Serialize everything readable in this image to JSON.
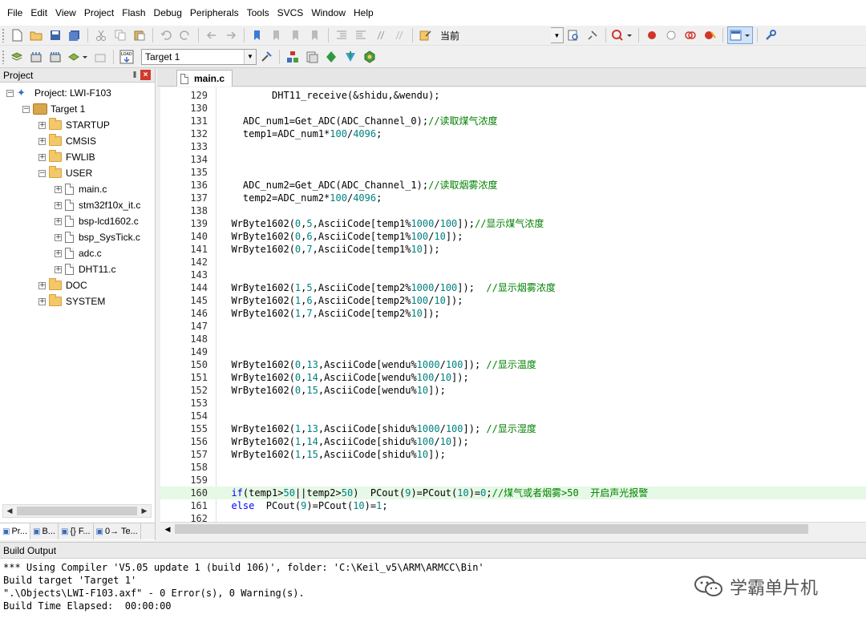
{
  "menu": [
    "File",
    "Edit",
    "View",
    "Project",
    "Flash",
    "Debug",
    "Peripherals",
    "Tools",
    "SVCS",
    "Window",
    "Help"
  ],
  "toolbar1": {
    "current_label": "当前"
  },
  "toolbar2": {
    "target_combo": "Target 1",
    "load_label": "LOAD"
  },
  "project_panel": {
    "title": "Project",
    "pin_glyph": "‖",
    "close_glyph": "×",
    "tree": [
      {
        "label": "Project: LWI-F103",
        "depth": 0,
        "kind": "project",
        "expander": "−"
      },
      {
        "label": "Target 1",
        "depth": 1,
        "kind": "target",
        "expander": "−"
      },
      {
        "label": "STARTUP",
        "depth": 2,
        "kind": "folder",
        "expander": "+"
      },
      {
        "label": "CMSIS",
        "depth": 2,
        "kind": "folder",
        "expander": "+"
      },
      {
        "label": "FWLIB",
        "depth": 2,
        "kind": "folder",
        "expander": "+"
      },
      {
        "label": "USER",
        "depth": 2,
        "kind": "folder",
        "expander": "−"
      },
      {
        "label": "main.c",
        "depth": 3,
        "kind": "file",
        "expander": "+"
      },
      {
        "label": "stm32f10x_it.c",
        "depth": 3,
        "kind": "file",
        "expander": "+"
      },
      {
        "label": "bsp-lcd1602.c",
        "depth": 3,
        "kind": "file",
        "expander": "+"
      },
      {
        "label": "bsp_SysTick.c",
        "depth": 3,
        "kind": "file",
        "expander": "+"
      },
      {
        "label": "adc.c",
        "depth": 3,
        "kind": "file",
        "expander": "+"
      },
      {
        "label": "DHT11.c",
        "depth": 3,
        "kind": "file",
        "expander": "+"
      },
      {
        "label": "DOC",
        "depth": 2,
        "kind": "folder",
        "expander": "+"
      },
      {
        "label": "SYSTEM",
        "depth": 2,
        "kind": "folder",
        "expander": "+"
      }
    ],
    "tabs": [
      {
        "label": "Pr...",
        "icon": "project-icon"
      },
      {
        "label": "B...",
        "icon": "books-icon"
      },
      {
        "label": "{} F...",
        "icon": "functions-icon"
      },
      {
        "label": "0→ Te...",
        "icon": "templates-icon"
      }
    ]
  },
  "editor": {
    "active_tab": "main.c",
    "highlighted_line": 160,
    "lines": [
      {
        "n": "129",
        "code": "         DHT11_receive(&shidu,&wendu);"
      },
      {
        "n": "130",
        "code": ""
      },
      {
        "n": "131",
        "code": "    ADC_num1=Get_ADC(ADC_Channel_0);//读取煤气浓度"
      },
      {
        "n": "132",
        "code": "    temp1=ADC_num1*100/4096;"
      },
      {
        "n": "133",
        "code": ""
      },
      {
        "n": "134",
        "code": ""
      },
      {
        "n": "135",
        "code": ""
      },
      {
        "n": "136",
        "code": "    ADC_num2=Get_ADC(ADC_Channel_1);//读取烟雾浓度"
      },
      {
        "n": "137",
        "code": "    temp2=ADC_num2*100/4096;"
      },
      {
        "n": "138",
        "code": ""
      },
      {
        "n": "139",
        "code": "  WrByte1602(0,5,AsciiCode[temp1%1000/100]);//显示煤气浓度"
      },
      {
        "n": "140",
        "code": "  WrByte1602(0,6,AsciiCode[temp1%100/10]);"
      },
      {
        "n": "141",
        "code": "  WrByte1602(0,7,AsciiCode[temp1%10]);"
      },
      {
        "n": "142",
        "code": ""
      },
      {
        "n": "143",
        "code": ""
      },
      {
        "n": "144",
        "code": "  WrByte1602(1,5,AsciiCode[temp2%1000/100]);  //显示烟雾浓度"
      },
      {
        "n": "145",
        "code": "  WrByte1602(1,6,AsciiCode[temp2%100/10]);"
      },
      {
        "n": "146",
        "code": "  WrByte1602(1,7,AsciiCode[temp2%10]);"
      },
      {
        "n": "147",
        "code": ""
      },
      {
        "n": "148",
        "code": ""
      },
      {
        "n": "149",
        "code": ""
      },
      {
        "n": "150",
        "code": "  WrByte1602(0,13,AsciiCode[wendu%1000/100]); //显示温度"
      },
      {
        "n": "151",
        "code": "  WrByte1602(0,14,AsciiCode[wendu%100/10]);"
      },
      {
        "n": "152",
        "code": "  WrByte1602(0,15,AsciiCode[wendu%10]);"
      },
      {
        "n": "153",
        "code": ""
      },
      {
        "n": "154",
        "code": ""
      },
      {
        "n": "155",
        "code": "  WrByte1602(1,13,AsciiCode[shidu%1000/100]); //显示湿度"
      },
      {
        "n": "156",
        "code": "  WrByte1602(1,14,AsciiCode[shidu%100/10]);"
      },
      {
        "n": "157",
        "code": "  WrByte1602(1,15,AsciiCode[shidu%10]);"
      },
      {
        "n": "158",
        "code": ""
      },
      {
        "n": "159",
        "code": ""
      },
      {
        "n": "160",
        "code": "  if(temp1>50||temp2>50)  PCout(9)=PCout(10)=0;//煤气或者烟雾>50  开启声光报警"
      },
      {
        "n": "161",
        "code": "  else  PCout(9)=PCout(10)=1;"
      },
      {
        "n": "162",
        "code": ""
      }
    ]
  },
  "build_output": {
    "title": "Build Output",
    "lines": [
      "*** Using Compiler 'V5.05 update 1 (build 106)', folder: 'C:\\Keil_v5\\ARM\\ARMCC\\Bin'",
      "Build target 'Target 1'",
      "\".\\Objects\\LWI-F103.axf\" - 0 Error(s), 0 Warning(s).",
      "Build Time Elapsed:  00:00:00"
    ]
  },
  "watermark": {
    "text": "学霸单片机",
    "icon": "wechat-icon"
  },
  "colors": {
    "keyword": "#0000ff",
    "number": "#008080",
    "comment": "#008000",
    "current_line": "#e6f8e6"
  }
}
